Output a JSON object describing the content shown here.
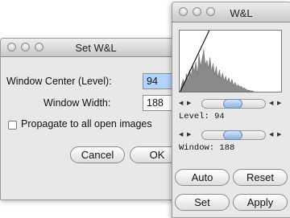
{
  "set_dialog": {
    "title": "Set W&L",
    "center_label": "Window Center (Level):",
    "center_value": "94",
    "width_label": "Window Width:",
    "width_value": "188",
    "propagate_label": "Propagate to all open images",
    "cancel": "Cancel",
    "ok": "OK"
  },
  "wl_panel": {
    "title": "W&L",
    "level_label": "Level:",
    "level_value": "94",
    "window_label": "Window:",
    "window_value": "188",
    "auto": "Auto",
    "reset": "Reset",
    "set": "Set",
    "apply": "Apply"
  }
}
